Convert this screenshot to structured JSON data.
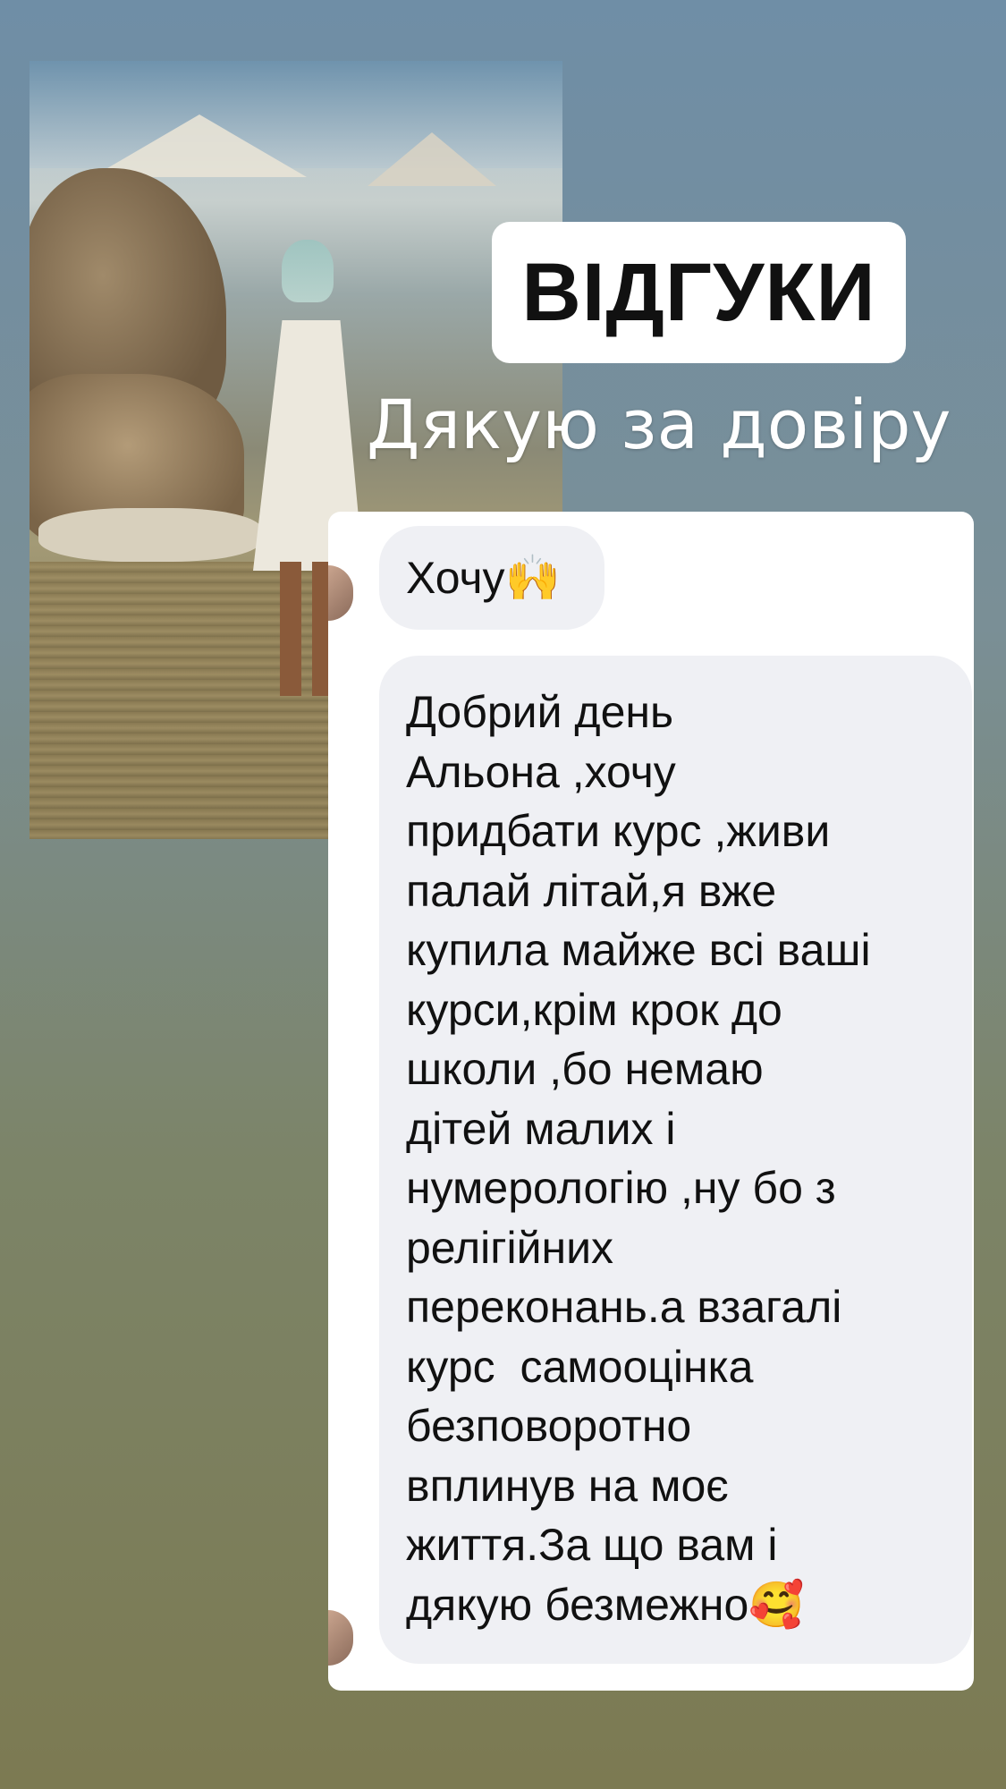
{
  "header": {
    "title": "ВІДГУКИ",
    "subtitle": "Дякую за довіру"
  },
  "messages": [
    {
      "text": "Хочу",
      "emoji": "🙌"
    },
    {
      "text": "Добрий день\nАльона ,хочу\nпридбати курс ,живи\nпалай літай,я вже\nкупила майже всі ваші\nкурси,крім крок до\nшколи ,бо немаю\nдітей малих і\nнумерологію ,ну бо з\nрелігійних\nпереконань.а взагалі\nкурс  самооцінка\nбезповоротно\nвплинув на моє\nжиття.За що вам і\nдякую безмежно",
      "emoji": "🥰"
    }
  ]
}
